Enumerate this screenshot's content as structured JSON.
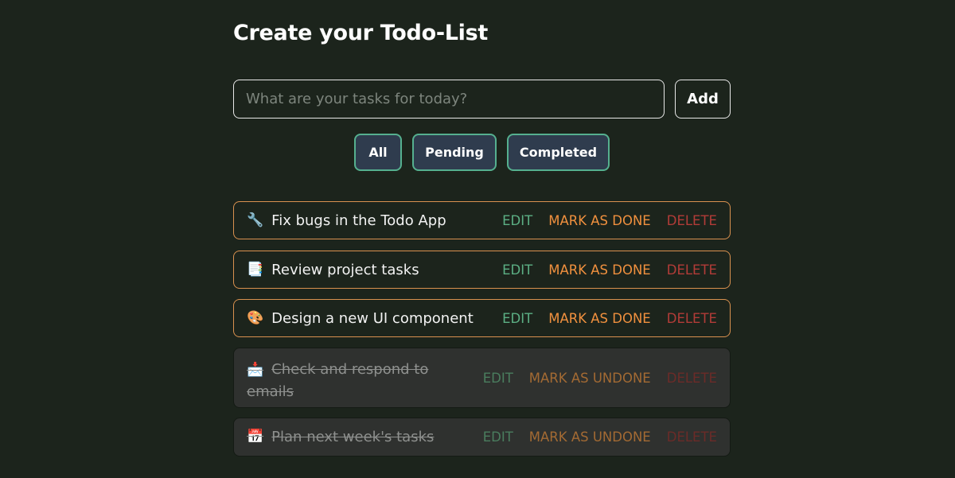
{
  "header": {
    "title": "Create your Todo-List"
  },
  "input": {
    "placeholder": "What are your tasks for today?",
    "value": "",
    "add_label": "Add"
  },
  "filters": [
    {
      "label": "All"
    },
    {
      "label": "Pending"
    },
    {
      "label": "Completed"
    }
  ],
  "todos": [
    {
      "icon": "🔧",
      "icon_name": "wrench-icon",
      "text": "Fix bugs in the Todo App",
      "status": "pending",
      "edit": "EDIT",
      "mark": "MARK AS DONE",
      "delete": "DELETE"
    },
    {
      "icon": "📑",
      "icon_name": "document-icon",
      "text": "Review project tasks",
      "status": "pending",
      "edit": "EDIT",
      "mark": "MARK AS DONE",
      "delete": "DELETE"
    },
    {
      "icon": "🎨",
      "icon_name": "palette-icon",
      "text": "Design a new UI component",
      "status": "pending",
      "edit": "EDIT",
      "mark": "MARK AS DONE",
      "delete": "DELETE"
    },
    {
      "icon": "📩",
      "icon_name": "envelope-icon",
      "text": "Check and respond to emails",
      "status": "done",
      "edit": "EDIT",
      "mark": "MARK AS UNDONE",
      "delete": "DELETE"
    },
    {
      "icon": "📅",
      "icon_name": "calendar-icon",
      "text": "Plan next week's tasks",
      "status": "done",
      "edit": "EDIT",
      "mark": "MARK AS UNDONE",
      "delete": "DELETE"
    }
  ],
  "colors": {
    "background": "#1c241c",
    "filter_border": "#55b08f",
    "filter_bg": "#2f3c4e",
    "pending_border": "#d9914f",
    "edit": "#5caf84",
    "mark": "#f0903e",
    "delete": "#b23c38"
  }
}
